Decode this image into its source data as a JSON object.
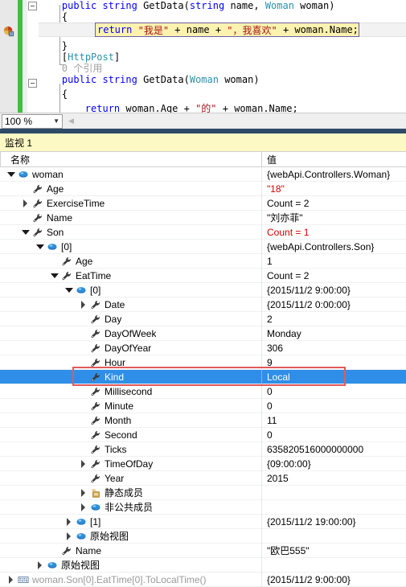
{
  "editor": {
    "zoom_level": "100 %",
    "dropdown_icon": "chevron-down-icon",
    "scroll_left_icon": "scroll-left-icon",
    "bookmark_icon": "breakpoint-glyph-icon",
    "lines": [
      {
        "id": "l1",
        "indent": 4,
        "segments": [
          {
            "t": "public ",
            "c": "kw"
          },
          {
            "t": "string ",
            "c": "kw"
          },
          {
            "t": "GetData(",
            "c": ""
          },
          {
            "t": "string",
            "c": "kw"
          },
          {
            "t": " name, ",
            "c": ""
          },
          {
            "t": "Woman",
            "c": "type"
          },
          {
            "t": " woman)",
            "c": ""
          }
        ]
      },
      {
        "id": "l2",
        "indent": 4,
        "segments": [
          {
            "t": "{",
            "c": ""
          }
        ]
      },
      {
        "id": "l4",
        "indent": 4,
        "segments": [
          {
            "t": "}",
            "c": ""
          }
        ]
      },
      {
        "id": "l5",
        "indent": 4,
        "segments": [
          {
            "t": "[",
            "c": ""
          },
          {
            "t": "HttpPost",
            "c": "type"
          },
          {
            "t": "]",
            "c": ""
          }
        ]
      },
      {
        "id": "l6",
        "indent": 4,
        "segments": [
          {
            "t": "0 个引用",
            "c": "gray"
          }
        ]
      },
      {
        "id": "l7",
        "indent": 4,
        "segments": [
          {
            "t": "public ",
            "c": "kw"
          },
          {
            "t": "string ",
            "c": "kw"
          },
          {
            "t": "GetData(",
            "c": ""
          },
          {
            "t": "Woman",
            "c": "type"
          },
          {
            "t": " woman)",
            "c": ""
          }
        ]
      },
      {
        "id": "l8",
        "indent": 4,
        "segments": [
          {
            "t": "{",
            "c": ""
          }
        ]
      },
      {
        "id": "l9",
        "indent": 8,
        "segments": [
          {
            "t": "return",
            "c": "kw"
          },
          {
            "t": " woman.Age + ",
            "c": ""
          },
          {
            "t": "\"的\"",
            "c": "str"
          },
          {
            "t": " + woman.Name;",
            "c": ""
          }
        ]
      }
    ],
    "highlighted_line": {
      "text": "return \"我是\" + name + \", 我喜欢\" + woman.Name;",
      "segments": [
        {
          "t": "return",
          "c": "kw"
        },
        {
          "t": " ",
          "c": ""
        },
        {
          "t": "\"我是\"",
          "c": "str"
        },
        {
          "t": " + name + ",
          "c": ""
        },
        {
          "t": "\"，我喜欢\"",
          "c": "str"
        },
        {
          "t": " + woman.Name;",
          "c": ""
        }
      ]
    }
  },
  "watch": {
    "title": "监视 1",
    "columns": {
      "name": "名称",
      "value": "值"
    },
    "rows": [
      {
        "indent": 0,
        "twisty": "expanded",
        "icon": "object-sphere-icon",
        "name": "woman",
        "value": "{webApi.Controllers.Woman}",
        "value_state": "normal",
        "selected": false
      },
      {
        "indent": 1,
        "twisty": "none",
        "icon": "property-wrench-icon",
        "name": "Age",
        "value": "\"18\"",
        "value_state": "changed",
        "selected": false
      },
      {
        "indent": 1,
        "twisty": "collapsed",
        "icon": "property-wrench-icon",
        "name": "ExerciseTime",
        "value": "Count = 2",
        "value_state": "normal",
        "selected": false
      },
      {
        "indent": 1,
        "twisty": "none",
        "icon": "property-wrench-icon",
        "name": "Name",
        "value": "\"刘亦菲\"",
        "value_state": "normal",
        "selected": false
      },
      {
        "indent": 1,
        "twisty": "expanded",
        "icon": "property-wrench-icon",
        "name": "Son",
        "value": "Count = 1",
        "value_state": "changed",
        "selected": false
      },
      {
        "indent": 2,
        "twisty": "expanded",
        "icon": "object-sphere-icon",
        "name": "[0]",
        "value": "{webApi.Controllers.Son}",
        "value_state": "normal",
        "selected": false
      },
      {
        "indent": 3,
        "twisty": "none",
        "icon": "property-wrench-icon",
        "name": "Age",
        "value": "1",
        "value_state": "normal",
        "selected": false
      },
      {
        "indent": 3,
        "twisty": "expanded",
        "icon": "property-wrench-icon",
        "name": "EatTime",
        "value": "Count = 2",
        "value_state": "normal",
        "selected": false
      },
      {
        "indent": 4,
        "twisty": "expanded",
        "icon": "object-sphere-icon",
        "name": "[0]",
        "value": "{2015/11/2 9:00:00}",
        "value_state": "normal",
        "selected": false
      },
      {
        "indent": 5,
        "twisty": "collapsed",
        "icon": "property-wrench-icon",
        "name": "Date",
        "value": "{2015/11/2 0:00:00}",
        "value_state": "normal",
        "selected": false
      },
      {
        "indent": 5,
        "twisty": "none",
        "icon": "property-wrench-icon",
        "name": "Day",
        "value": "2",
        "value_state": "normal",
        "selected": false
      },
      {
        "indent": 5,
        "twisty": "none",
        "icon": "property-wrench-icon",
        "name": "DayOfWeek",
        "value": "Monday",
        "value_state": "normal",
        "selected": false
      },
      {
        "indent": 5,
        "twisty": "none",
        "icon": "property-wrench-icon",
        "name": "DayOfYear",
        "value": "306",
        "value_state": "normal",
        "selected": false
      },
      {
        "indent": 5,
        "twisty": "none",
        "icon": "property-wrench-icon",
        "name": "Hour",
        "value": "9",
        "value_state": "normal",
        "selected": false
      },
      {
        "indent": 5,
        "twisty": "none",
        "icon": "property-wrench-icon",
        "name": "Kind",
        "value": "Local",
        "value_state": "normal",
        "selected": true
      },
      {
        "indent": 5,
        "twisty": "none",
        "icon": "property-wrench-icon",
        "name": "Millisecond",
        "value": "0",
        "value_state": "normal",
        "selected": false
      },
      {
        "indent": 5,
        "twisty": "none",
        "icon": "property-wrench-icon",
        "name": "Minute",
        "value": "0",
        "value_state": "normal",
        "selected": false
      },
      {
        "indent": 5,
        "twisty": "none",
        "icon": "property-wrench-icon",
        "name": "Month",
        "value": "11",
        "value_state": "normal",
        "selected": false
      },
      {
        "indent": 5,
        "twisty": "none",
        "icon": "property-wrench-icon",
        "name": "Second",
        "value": "0",
        "value_state": "normal",
        "selected": false
      },
      {
        "indent": 5,
        "twisty": "none",
        "icon": "property-wrench-icon",
        "name": "Ticks",
        "value": "635820516000000000",
        "value_state": "normal",
        "selected": false
      },
      {
        "indent": 5,
        "twisty": "collapsed",
        "icon": "property-wrench-icon",
        "name": "TimeOfDay",
        "value": "{09:00:00}",
        "value_state": "normal",
        "selected": false
      },
      {
        "indent": 5,
        "twisty": "none",
        "icon": "property-wrench-icon",
        "name": "Year",
        "value": "2015",
        "value_state": "normal",
        "selected": false
      },
      {
        "indent": 5,
        "twisty": "collapsed",
        "icon": "static-members-icon",
        "name": "静态成员",
        "value": "",
        "value_state": "normal",
        "selected": false
      },
      {
        "indent": 5,
        "twisty": "collapsed",
        "icon": "object-sphere-icon",
        "name": "非公共成员",
        "value": "",
        "value_state": "normal",
        "selected": false
      },
      {
        "indent": 4,
        "twisty": "collapsed",
        "icon": "object-sphere-icon",
        "name": "[1]",
        "value": "{2015/11/2 19:00:00}",
        "value_state": "normal",
        "selected": false
      },
      {
        "indent": 4,
        "twisty": "collapsed",
        "icon": "object-sphere-icon",
        "name": "原始视图",
        "value": "",
        "value_state": "normal",
        "selected": false
      },
      {
        "indent": 3,
        "twisty": "none",
        "icon": "property-wrench-icon",
        "name": "Name",
        "value": "\"欧巴555\"",
        "value_state": "normal",
        "selected": false
      },
      {
        "indent": 2,
        "twisty": "collapsed",
        "icon": "object-sphere-icon",
        "name": "原始视图",
        "value": "",
        "value_state": "normal",
        "selected": false
      },
      {
        "indent": 0,
        "twisty": "collapsed",
        "icon": "watch-expression-icon",
        "name": "woman.Son[0].EatTime[0].ToLocalTime()",
        "value": "{2015/11/2 9:00:00}",
        "value_state": "normal",
        "name_state": "dim",
        "selected": false
      }
    ],
    "annotation": {
      "shape": "red-rectangle",
      "around_row": "Kind",
      "color": "#e05a5a"
    }
  },
  "colors": {
    "selection_blue": "#2f8fe8",
    "changed_value_red": "#d00000",
    "watch_title_yellow": "#fdf9c4",
    "change_bar_green": "#3fc13f",
    "annotation_red": "#e05a5a",
    "highlight_yellow": "#fdf2b0"
  }
}
